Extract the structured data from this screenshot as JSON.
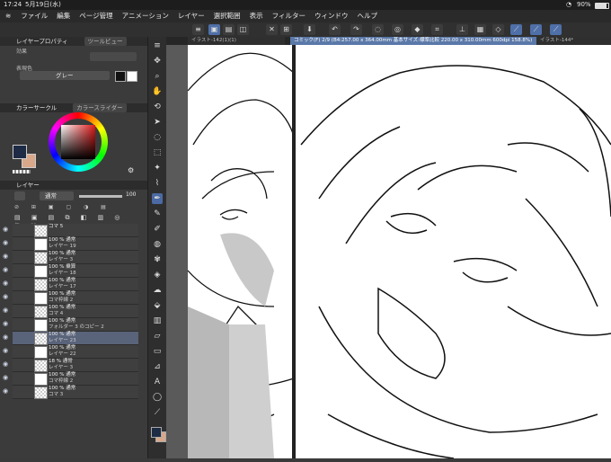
{
  "status": {
    "time": "17:24",
    "date": "5月19日(水)",
    "wifi": "wifi",
    "battery": "90%"
  },
  "menu": [
    "ファイル",
    "編集",
    "ページ管理",
    "アニメーション",
    "レイヤー",
    "選択範囲",
    "表示",
    "フィルター",
    "ウィンドウ",
    "ヘルプ"
  ],
  "layer_property": {
    "title": "レイヤープロパティ",
    "tab2": "ツールビュー",
    "effect_label": "効果",
    "color_label": "表現色",
    "color_value": "グレー"
  },
  "color_panel": {
    "title": "カラーサークル",
    "tab2": "カラースライダー"
  },
  "layer_panel": {
    "title": "レイヤー",
    "blend_mode": "通常",
    "opacity": "100",
    "rows": [
      {
        "line1": "コマ 5",
        "line2": ""
      },
      {
        "line1": "100 % 通常",
        "line2": "レイヤー 19"
      },
      {
        "line1": "100 % 通常",
        "line2": "レイヤー 3"
      },
      {
        "line1": "100 % 乗算",
        "line2": "レイヤー 18"
      },
      {
        "line1": "100 % 通常",
        "line2": "レイヤー 17"
      },
      {
        "line1": "100 % 通常",
        "line2": "コマ枠線 2"
      },
      {
        "line1": "100 % 通常",
        "line2": "コマ 4"
      },
      {
        "line1": "100 % 通常",
        "line2": "フォルダー 3 のコピー 2"
      },
      {
        "line1": "100 % 通常",
        "line2": "レイヤー 23"
      },
      {
        "line1": "100 % 通常",
        "line2": "レイヤー 22"
      },
      {
        "line1": "18 % 通常",
        "line2": "レイヤー 3"
      },
      {
        "line1": "100 % 通常",
        "line2": "コマ枠線 2"
      },
      {
        "line1": "100 % 通常",
        "line2": "コマ 3"
      }
    ]
  },
  "doc_tabs": [
    {
      "label": "イラスト-142(1)(1)"
    },
    {
      "label": "コミック(F) 2/9 (B4:257.00 x 364.00mm 基本サイズ:標準比較 220.00 x 310.00mm 600dpi 158.8%)"
    },
    {
      "label": "イラスト-144*"
    }
  ],
  "tools": [
    "menu",
    "move",
    "zoom",
    "hand",
    "rotate",
    "operation",
    "lasso",
    "select",
    "wand",
    "eyedropper",
    "pen",
    "pencil",
    "brush",
    "airbrush",
    "decoration",
    "eraser",
    "blend",
    "fill",
    "gradient",
    "figure",
    "frame",
    "ruler",
    "text",
    "balloon",
    "correction"
  ],
  "colors": {
    "accent": "#5a78a8",
    "selected_row": "#59637a",
    "main_color": "#1d2b45",
    "sub_color": "#d9a88a"
  }
}
